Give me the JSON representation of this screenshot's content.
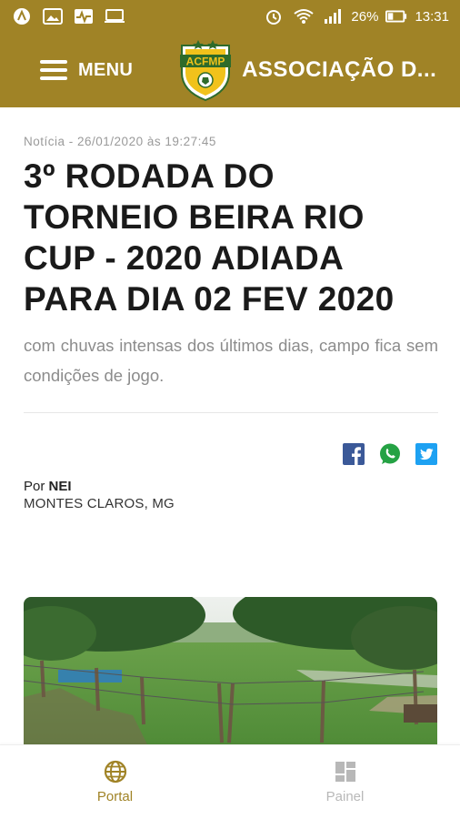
{
  "status_bar": {
    "battery_percent": "26%",
    "time": "13:31"
  },
  "app_bar": {
    "menu_label": "MENU",
    "logo_text": "ACFMP",
    "title": "ASSOCIAÇÃO D..."
  },
  "article": {
    "meta": "Notícia - 26/01/2020 às 19:27:45",
    "headline": "3º RODADA DO TORNEIO BEIRA RIO CUP - 2020 ADIADA PARA DIA 02 FEV 2020",
    "lede": "com chuvas intensas dos últimos dias, campo fica sem condições de jogo.",
    "author_prefix": "Por",
    "author_name": "NEI",
    "location": "MONTES CLAROS, MG"
  },
  "share": {
    "icons": [
      "facebook-icon",
      "whatsapp-icon",
      "twitter-icon"
    ]
  },
  "bottom_nav": {
    "items": [
      {
        "label": "Portal",
        "icon": "globe-icon",
        "active": true
      },
      {
        "label": "Painel",
        "icon": "dashboard-icon",
        "active": false
      }
    ]
  },
  "colors": {
    "brand": "#a08326",
    "facebook": "#3b5998",
    "whatsapp": "#25a244",
    "twitter": "#1da1f2"
  }
}
